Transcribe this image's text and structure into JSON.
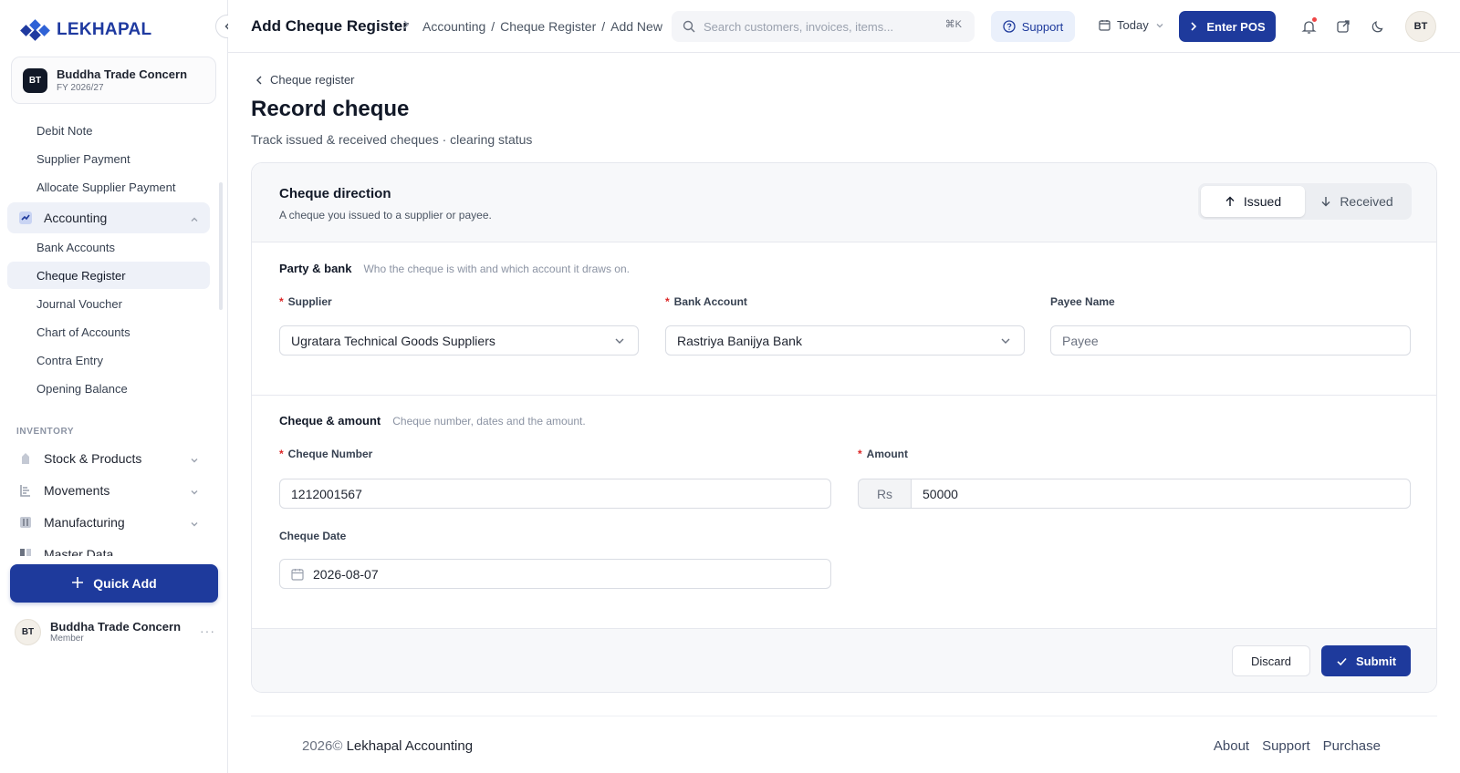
{
  "brand": {
    "name": "LEKHAPAL"
  },
  "org": {
    "initials": "BT",
    "name": "Buddha Trade Concern",
    "fy": "FY 2026/27"
  },
  "sidebar": {
    "purchase_items": [
      {
        "label": "Debit Note"
      },
      {
        "label": "Supplier Payment"
      },
      {
        "label": "Allocate Supplier Payment"
      }
    ],
    "accounting": {
      "label": "Accounting"
    },
    "accounting_items": [
      {
        "label": "Bank Accounts"
      },
      {
        "label": "Cheque Register"
      },
      {
        "label": "Journal Voucher"
      },
      {
        "label": "Chart of Accounts"
      },
      {
        "label": "Contra Entry"
      },
      {
        "label": "Opening Balance"
      }
    ],
    "inventory_section": "INVENTORY",
    "inventory_groups": [
      {
        "label": "Stock & Products"
      },
      {
        "label": "Movements"
      },
      {
        "label": "Manufacturing"
      },
      {
        "label": "Master Data"
      }
    ],
    "quick_add": "Quick Add",
    "user": {
      "initials": "BT",
      "name": "Buddha Trade Concern",
      "role": "Member"
    }
  },
  "header": {
    "title": "Add Cheque Register",
    "breadcrumb": [
      "Accounting",
      "/",
      "Cheque Register",
      "/",
      "Add New"
    ],
    "search_placeholder": "Search customers, invoices, items...",
    "search_shortcut": "⌘K",
    "support": "Support",
    "date_range": "Today",
    "enter_pos": "Enter POS",
    "avatar": "BT"
  },
  "page": {
    "back_label": "Cheque register",
    "title": "Record cheque",
    "subtitle": "Track issued & received cheques · clearing status"
  },
  "direction": {
    "title": "Cheque direction",
    "description": "A cheque you issued to a supplier or payee.",
    "options": [
      "Issued",
      "Received"
    ],
    "selected": "Issued"
  },
  "party_bank": {
    "title": "Party & bank",
    "description": "Who the cheque is with and which account it draws on.",
    "supplier_label": "Supplier",
    "supplier_value": "Ugratara Technical Goods Suppliers",
    "bank_label": "Bank Account",
    "bank_value": "Rastriya Banijya Bank",
    "payee_label": "Payee Name",
    "payee_placeholder": "Payee"
  },
  "cheque_amount": {
    "title": "Cheque & amount",
    "description": "Cheque number, dates and the amount.",
    "number_label": "Cheque Number",
    "number_value": "1212001567",
    "amount_label": "Amount",
    "currency": "Rs",
    "amount_value": "50000",
    "date_label": "Cheque Date",
    "date_value": "2026-08-07"
  },
  "actions": {
    "discard": "Discard",
    "submit": "Submit"
  },
  "footer": {
    "year": "2026©",
    "company": "Lekhapal Accounting",
    "links": [
      "About",
      "Support",
      "Purchase"
    ]
  },
  "colors": {
    "primary": "#1e3a9c",
    "required": "#dc2626",
    "active_nav": "#eef1f8"
  }
}
